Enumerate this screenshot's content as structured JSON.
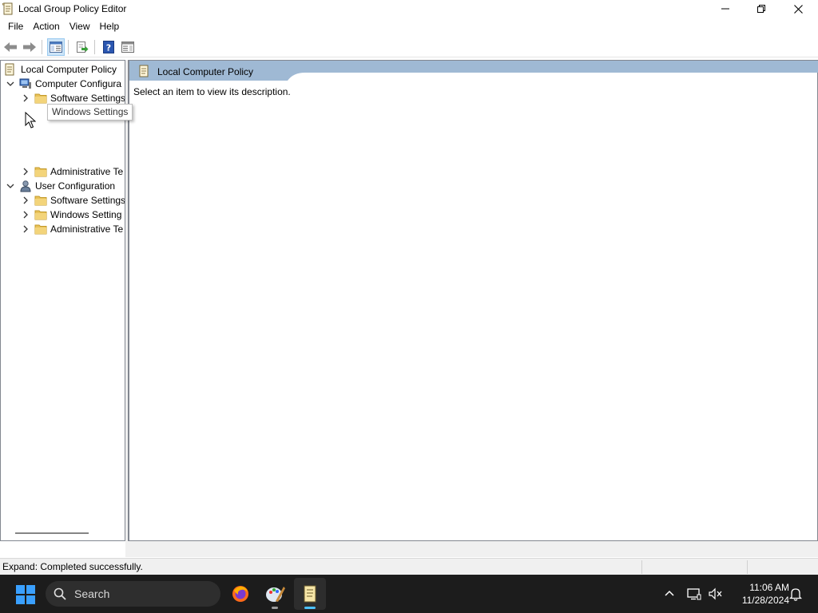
{
  "window": {
    "title": "Local Group Policy Editor"
  },
  "menu": [
    "File",
    "Action",
    "View",
    "Help"
  ],
  "tree": {
    "root": "Local Computer Policy",
    "items": [
      {
        "label": "Computer Configura",
        "level": 1,
        "expanded": true
      },
      {
        "label": "Software Settings",
        "level": 2,
        "expanded": false
      },
      {
        "label": "Administrative Te",
        "level": 2,
        "expanded": false
      },
      {
        "label": "User Configuration",
        "level": 1,
        "expanded": true
      },
      {
        "label": "Software Settings",
        "level": 2,
        "expanded": false
      },
      {
        "label": "Windows Setting",
        "level": 2,
        "expanded": false
      },
      {
        "label": "Administrative Te",
        "level": 2,
        "expanded": false
      }
    ]
  },
  "tooltip": "Windows Settings",
  "right_pane": {
    "header": "Local Computer Policy",
    "description": "Select an item to view its description."
  },
  "status": {
    "text": "Expand:  Completed successfully."
  },
  "taskbar": {
    "search_label": "Search",
    "time": "11:06 AM",
    "date": "11/28/2024"
  },
  "colors": {
    "header_band": "#9fb9d4",
    "taskbar": "#1c1c1c",
    "folder": "#e8c25a",
    "windows_blue": "#0a84ff"
  }
}
